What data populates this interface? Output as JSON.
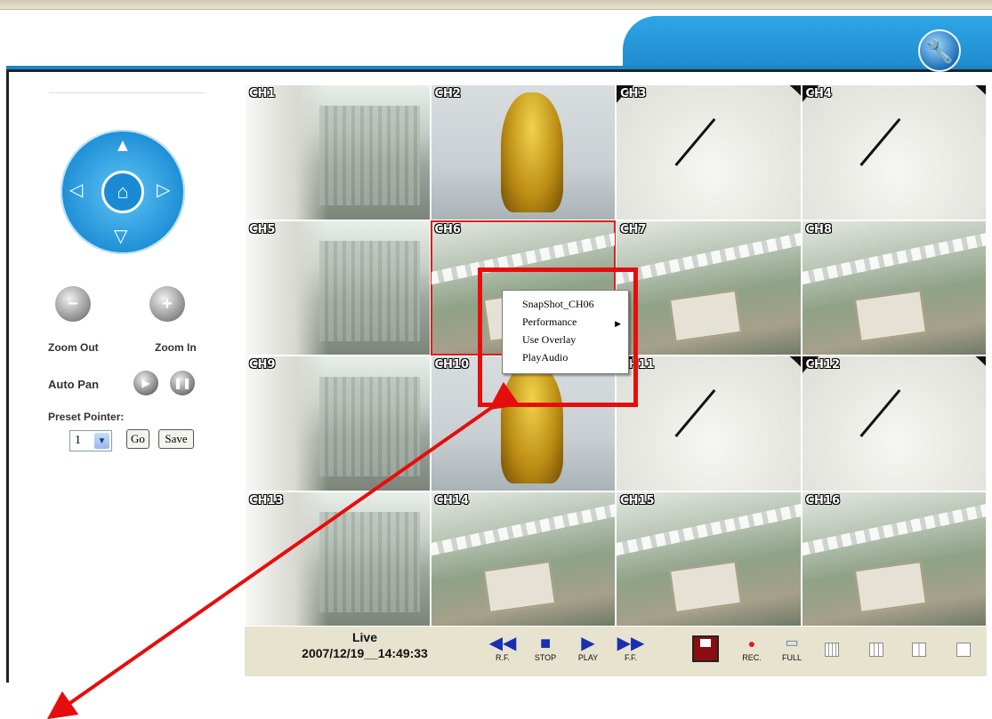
{
  "settings_button": {
    "icon": "wrench-icon"
  },
  "ptz": {
    "up_icon": "▲",
    "down_icon": "▽",
    "left_icon": "◁",
    "right_icon": "▷",
    "home_icon": "⌂"
  },
  "zoom": {
    "out_label": "Zoom Out",
    "in_label": "Zoom In",
    "out_glyph": "−",
    "in_glyph": "+"
  },
  "auto_pan": {
    "label": "Auto Pan",
    "play_glyph": "▶",
    "pause_glyph": "❚❚"
  },
  "preset": {
    "label": "Preset Pointer:",
    "value": "1",
    "go_label": "Go",
    "save_label": "Save"
  },
  "channels": [
    {
      "label": "CH1",
      "scene": "city"
    },
    {
      "label": "CH2",
      "scene": "cat"
    },
    {
      "label": "CH3",
      "scene": "clock"
    },
    {
      "label": "CH4",
      "scene": "clock"
    },
    {
      "label": "CH5",
      "scene": "city"
    },
    {
      "label": "CH6",
      "scene": "aerial",
      "selected": true
    },
    {
      "label": "CH7",
      "scene": "aerial"
    },
    {
      "label": "CH8",
      "scene": "aerial"
    },
    {
      "label": "CH9",
      "scene": "city"
    },
    {
      "label": "CH10",
      "scene": "cat"
    },
    {
      "label": "CH11",
      "scene": "clock"
    },
    {
      "label": "CH12",
      "scene": "clock"
    },
    {
      "label": "CH13",
      "scene": "city"
    },
    {
      "label": "CH14",
      "scene": "aerial"
    },
    {
      "label": "CH15",
      "scene": "aerial"
    },
    {
      "label": "CH16",
      "scene": "aerial"
    }
  ],
  "context_menu": {
    "items": [
      "SnapShot_CH06",
      "Performance",
      "Use Overlay",
      "PlayAudio"
    ],
    "submenu_indicator": "▶"
  },
  "status": {
    "mode": "Live",
    "datetime": "2007/12/19__14:49:33"
  },
  "playback": {
    "rf": {
      "label": "R.F.",
      "glyph": "◀◀"
    },
    "stop": {
      "label": "STOP",
      "glyph": "■"
    },
    "play": {
      "label": "PLAY",
      "glyph": "▶"
    },
    "ff": {
      "label": "F.F.",
      "glyph": "▶▶"
    }
  },
  "right_controls": {
    "save_icon": "floppy-icon",
    "rec_label": "REC.",
    "full_label": "FULL"
  },
  "colors": {
    "accent_blue": "#1c86c9",
    "highlight_red": "#e70d0d"
  }
}
